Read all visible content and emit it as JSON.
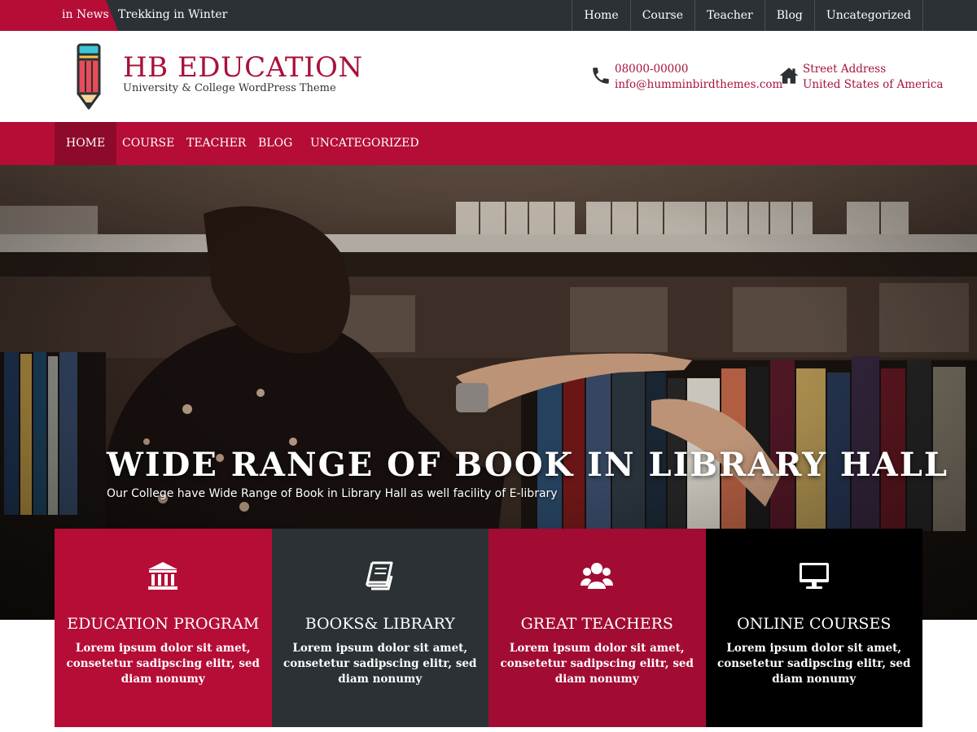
{
  "topbar": {
    "news_label": "in News",
    "news_headline": "Trekking in Winter",
    "menu": [
      "Home",
      "Course",
      "Teacher",
      "Blog",
      "Uncategorized"
    ]
  },
  "header": {
    "logo_icon": "pencil-icon",
    "title": "HB EDUCATION",
    "tagline": "University & College WordPress Theme",
    "phone": "08000-00000",
    "email": "info@humminbirdthemes.com",
    "address_line1": "Street Address",
    "address_line2": "United States of America"
  },
  "nav": {
    "items": [
      "HOME",
      "COURSE",
      "TEACHER",
      "BLOG",
      "UNCATEGORIZED"
    ],
    "active": "HOME"
  },
  "hero": {
    "title": "WIDE RANGE OF BOOK IN LIBRARY HALL",
    "subtitle": "Our College have Wide Range of Book in Library Hall as well facility of E-library"
  },
  "features": [
    {
      "icon": "building-icon",
      "title": "EDUCATION PROGRAM",
      "text": "Lorem ipsum dolor sit amet, consetetur sadipscing elitr, sed diam nonumy"
    },
    {
      "icon": "book-icon",
      "title": "BOOKS& LIBRARY",
      "text": "Lorem ipsum dolor sit amet, consetetur sadipscing elitr, sed diam nonumy"
    },
    {
      "icon": "users-icon",
      "title": "GREAT TEACHERS",
      "text": "Lorem ipsum dolor sit amet, consetetur sadipscing elitr, sed diam nonumy"
    },
    {
      "icon": "monitor-icon",
      "title": "ONLINE COURSES",
      "text": "Lorem ipsum dolor sit amet, consetetur sadipscing elitr, sed diam nonumy"
    }
  ],
  "colors": {
    "accent": "#b50d36",
    "dark": "#2b3134",
    "title": "#a8123a"
  }
}
